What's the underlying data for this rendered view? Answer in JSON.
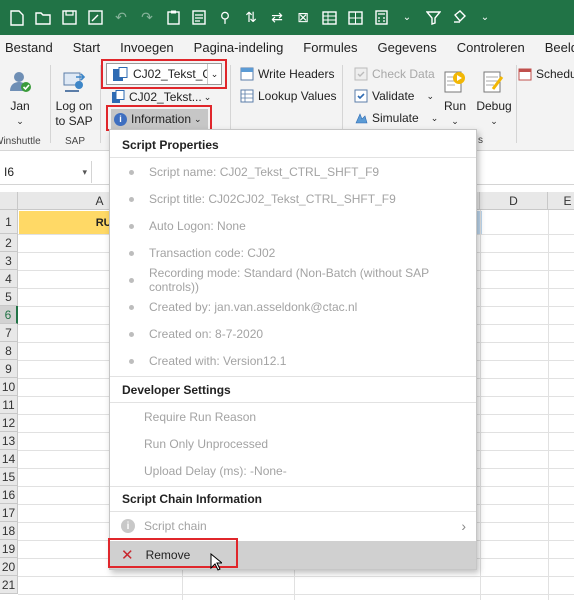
{
  "quick_access": {
    "icons": [
      "new-file-icon",
      "open-file-icon",
      "save-icon",
      "edit-icon",
      "undo-icon",
      "redo-icon",
      "paste-icon",
      "preview-icon",
      "format-painter-icon",
      "sort-icon",
      "filter-icon",
      "more-icon",
      "chevron-down-icon",
      "funnel-icon",
      "bucket-icon"
    ]
  },
  "tabs": [
    "Bestand",
    "Start",
    "Invoegen",
    "Pagina-indeling",
    "Formules",
    "Gegevens",
    "Controleren",
    "Beeld"
  ],
  "ribbon": {
    "jan_label": "Jan",
    "winshuttle_group": "Winshuttle",
    "logon_label_1": "Log on",
    "logon_label_2": "to SAP",
    "sap_group": "SAP",
    "script_combo_value": "CJ02_Tekst_C...",
    "script_combo2_value": "CJ02_Tekst...",
    "information_label": "Information",
    "write_headers": "Write Headers",
    "lookup_values": "Lookup Values",
    "check_data": "Check Data",
    "validate": "Validate",
    "simulate": "Simulate",
    "run_label": "Run",
    "debug_label": "Debug",
    "schedule_label": "Schedul",
    "group_suffix": "s"
  },
  "formula_bar": {
    "name_box": "I6"
  },
  "grid": {
    "columns": [
      "A",
      "D",
      "E"
    ],
    "rows": [
      "1",
      "2",
      "3",
      "4",
      "5",
      "6",
      "7",
      "8",
      "9",
      "10",
      "11",
      "12",
      "13",
      "14",
      "15",
      "16",
      "17",
      "18",
      "19",
      "20",
      "21"
    ],
    "active_row": "6",
    "a1_text": "RUN L"
  },
  "menu": {
    "script_properties_title": "Script Properties",
    "properties": [
      "Script name: CJ02_Tekst_CTRL_SHFT_F9",
      "Script title: CJ02CJ02_Tekst_CTRL_SHFT_F9",
      "Auto Logon: None",
      "Transaction code: CJ02",
      "Recording mode: Standard (Non-Batch (without SAP controls))",
      "Created by: jan.van.asseldonk@ctac.nl",
      "Created on: 8-7-2020",
      "Created with: Version12.1"
    ],
    "developer_settings_title": "Developer Settings",
    "developer_settings": [
      "Require Run Reason",
      "Run Only Unprocessed",
      "Upload Delay (ms): -None-"
    ],
    "chain_title": "Script Chain Information",
    "script_chain": "Script chain",
    "remove": "Remove"
  },
  "colors": {
    "excel_green": "#217346",
    "highlight_red": "#e0262b",
    "header_yellow": "#ffd966",
    "remove_x": "#c8262d"
  }
}
